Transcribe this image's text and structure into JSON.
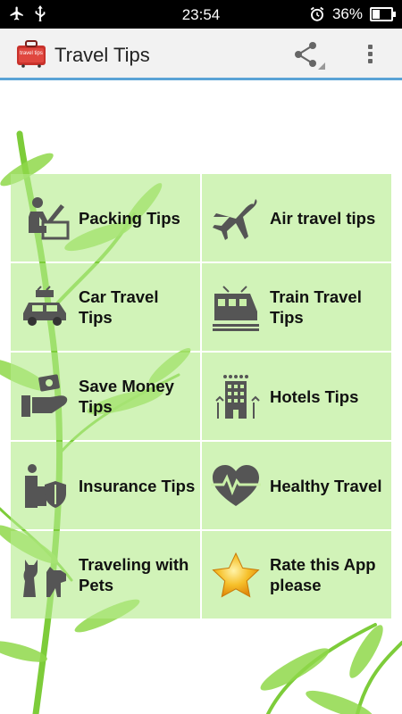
{
  "status_bar": {
    "time": "23:54",
    "battery": "36%",
    "battery_level": 0.36
  },
  "app_bar": {
    "title": "Travel Tips",
    "logo_text": "travel tips"
  },
  "tiles": [
    {
      "label": "Packing Tips",
      "icon": "packing-icon"
    },
    {
      "label": "Air travel tips",
      "icon": "airplane-icon"
    },
    {
      "label": "Car Travel Tips",
      "icon": "car-icon"
    },
    {
      "label": "Train Travel Tips",
      "icon": "train-icon"
    },
    {
      "label": "Save Money Tips",
      "icon": "money-hand-icon"
    },
    {
      "label": "Hotels Tips",
      "icon": "hotel-icon"
    },
    {
      "label": "Insurance Tips",
      "icon": "insurance-shield-icon"
    },
    {
      "label": "Healthy Travel",
      "icon": "heartbeat-icon"
    },
    {
      "label": "Traveling with Pets",
      "icon": "pets-icon"
    },
    {
      "label": "Rate this App please",
      "icon": "star-icon"
    }
  ],
  "colors": {
    "tile_bg": "#b4eb8c",
    "accent_line": "#5aa3d6",
    "icon_gray": "#555555",
    "star": "#f2b21c"
  }
}
